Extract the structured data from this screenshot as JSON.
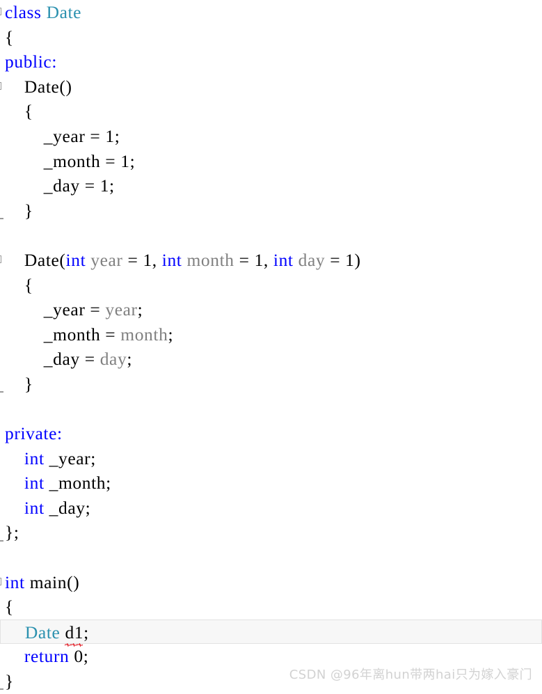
{
  "editor": {
    "language": "cpp",
    "background_color": "#ffffff",
    "colors": {
      "keyword": "#0000ff",
      "type": "#2b91af",
      "parameter": "#808080",
      "plain": "#000000",
      "error_squiggle": "#e01b24",
      "current_line_background": "#f7f7f7",
      "current_line_border": "#e2e2e2",
      "fold_marker": "#9a9a9a",
      "watermark": "#d2d2d2"
    },
    "fold_markers": [
      {
        "type": "box",
        "line": 0
      },
      {
        "type": "box",
        "line": 3
      },
      {
        "type": "end",
        "line": 8
      },
      {
        "type": "box",
        "line": 10
      },
      {
        "type": "end",
        "line": 15
      },
      {
        "type": "end",
        "line": 21
      },
      {
        "type": "box",
        "line": 23
      },
      {
        "type": "end",
        "line": 27
      }
    ],
    "current_line_index": 25,
    "error": {
      "token": "d1",
      "line_index": 25,
      "kind": "red-squiggle"
    }
  },
  "code": {
    "lines": [
      {
        "tokens": [
          {
            "t": "class",
            "c": "kw"
          },
          {
            "t": " ",
            "c": "pln"
          },
          {
            "t": "Date",
            "c": "type"
          }
        ]
      },
      {
        "tokens": [
          {
            "t": "{",
            "c": "pln"
          }
        ]
      },
      {
        "tokens": [
          {
            "t": "public:",
            "c": "kw"
          }
        ]
      },
      {
        "tokens": [
          {
            "t": "    Date()",
            "c": "pln"
          }
        ]
      },
      {
        "tokens": [
          {
            "t": "    {",
            "c": "pln"
          }
        ]
      },
      {
        "tokens": [
          {
            "t": "        _year = 1;",
            "c": "pln"
          }
        ]
      },
      {
        "tokens": [
          {
            "t": "        _month = 1;",
            "c": "pln"
          }
        ]
      },
      {
        "tokens": [
          {
            "t": "        _day = 1;",
            "c": "pln"
          }
        ]
      },
      {
        "tokens": [
          {
            "t": "    }",
            "c": "pln"
          }
        ]
      },
      {
        "tokens": []
      },
      {
        "tokens": [
          {
            "t": "    Date(",
            "c": "pln"
          },
          {
            "t": "int",
            "c": "kw"
          },
          {
            "t": " ",
            "c": "pln"
          },
          {
            "t": "year",
            "c": "par"
          },
          {
            "t": " = 1, ",
            "c": "pln"
          },
          {
            "t": "int",
            "c": "kw"
          },
          {
            "t": " ",
            "c": "pln"
          },
          {
            "t": "month",
            "c": "par"
          },
          {
            "t": " = 1, ",
            "c": "pln"
          },
          {
            "t": "int",
            "c": "kw"
          },
          {
            "t": " ",
            "c": "pln"
          },
          {
            "t": "day",
            "c": "par"
          },
          {
            "t": " = 1)",
            "c": "pln"
          }
        ]
      },
      {
        "tokens": [
          {
            "t": "    {",
            "c": "pln"
          }
        ]
      },
      {
        "tokens": [
          {
            "t": "        _year = ",
            "c": "pln"
          },
          {
            "t": "year",
            "c": "par"
          },
          {
            "t": ";",
            "c": "pln"
          }
        ]
      },
      {
        "tokens": [
          {
            "t": "        _month = ",
            "c": "pln"
          },
          {
            "t": "month",
            "c": "par"
          },
          {
            "t": ";",
            "c": "pln"
          }
        ]
      },
      {
        "tokens": [
          {
            "t": "        _day = ",
            "c": "pln"
          },
          {
            "t": "day",
            "c": "par"
          },
          {
            "t": ";",
            "c": "pln"
          }
        ]
      },
      {
        "tokens": [
          {
            "t": "    }",
            "c": "pln"
          }
        ]
      },
      {
        "tokens": []
      },
      {
        "tokens": [
          {
            "t": "private:",
            "c": "kw"
          }
        ]
      },
      {
        "tokens": [
          {
            "t": "    ",
            "c": "pln"
          },
          {
            "t": "int",
            "c": "kw"
          },
          {
            "t": " _year;",
            "c": "pln"
          }
        ]
      },
      {
        "tokens": [
          {
            "t": "    ",
            "c": "pln"
          },
          {
            "t": "int",
            "c": "kw"
          },
          {
            "t": " _month;",
            "c": "pln"
          }
        ]
      },
      {
        "tokens": [
          {
            "t": "    ",
            "c": "pln"
          },
          {
            "t": "int",
            "c": "kw"
          },
          {
            "t": " _day;",
            "c": "pln"
          }
        ]
      },
      {
        "tokens": [
          {
            "t": "};",
            "c": "pln"
          }
        ]
      },
      {
        "tokens": []
      },
      {
        "tokens": [
          {
            "t": "int",
            "c": "kw"
          },
          {
            "t": " main()",
            "c": "pln"
          }
        ]
      },
      {
        "tokens": [
          {
            "t": "{",
            "c": "pln"
          }
        ]
      },
      {
        "tokens": [
          {
            "t": "    ",
            "c": "pln"
          },
          {
            "t": "Date",
            "c": "type"
          },
          {
            "t": " ",
            "c": "pln"
          },
          {
            "t": "d1",
            "c": "pln",
            "err": true
          },
          {
            "t": ";",
            "c": "pln"
          }
        ]
      },
      {
        "tokens": [
          {
            "t": "    ",
            "c": "pln"
          },
          {
            "t": "return",
            "c": "kw"
          },
          {
            "t": " 0;",
            "c": "pln"
          }
        ]
      },
      {
        "tokens": [
          {
            "t": "}",
            "c": "pln"
          }
        ]
      }
    ]
  },
  "watermark": {
    "text": "CSDN @96年离hun带两hai只为嫁入豪门"
  }
}
